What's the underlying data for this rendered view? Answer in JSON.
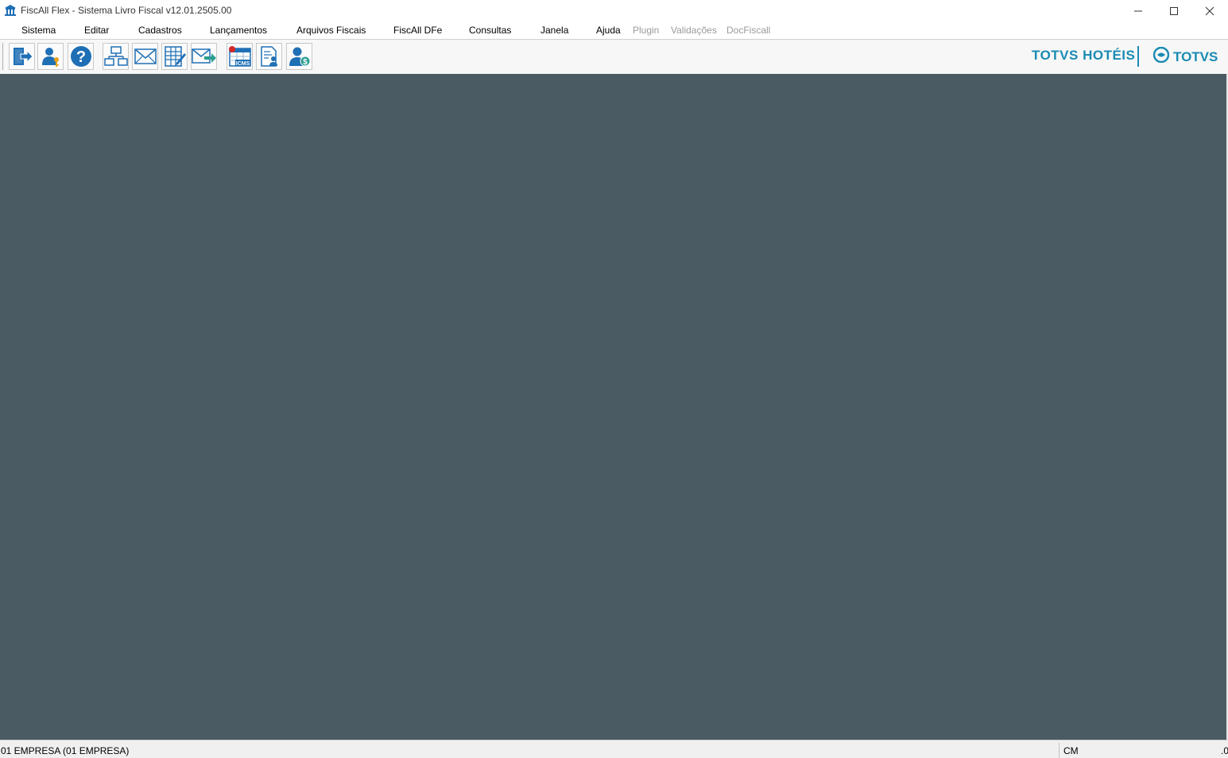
{
  "window": {
    "title": "FiscAll Flex - Sistema Livro Fiscal v12.01.2505.00",
    "icon": "app-building-icon",
    "controls": [
      "minimize-icon",
      "maximize-icon",
      "close-icon"
    ]
  },
  "menu": {
    "items": [
      {
        "label": "Sistema",
        "enabled": true
      },
      {
        "label": "Editar",
        "enabled": true
      },
      {
        "label": "Cadastros",
        "enabled": true
      },
      {
        "label": "Lançamentos",
        "enabled": true
      },
      {
        "label": "Arquivos Fiscais",
        "enabled": true
      },
      {
        "label": "FiscAll DFe",
        "enabled": true
      },
      {
        "label": "Consultas",
        "enabled": true
      },
      {
        "label": "Janela",
        "enabled": true
      },
      {
        "label": "Ajuda",
        "enabled": true
      },
      {
        "label": "Plugin",
        "enabled": false
      },
      {
        "label": "Validações",
        "enabled": false
      },
      {
        "label": "DocFiscall",
        "enabled": false
      }
    ]
  },
  "toolbar": {
    "buttons": [
      "exit-icon",
      "user-key-icon",
      "help-icon",
      "network-icon",
      "envelope-icon",
      "edit-spreadsheet-icon",
      "send-mail-icon",
      "icms-calendar-icon",
      "user-document-icon",
      "user-money-icon"
    ]
  },
  "brand": {
    "hoteis": "TOTVS HOTÉIS",
    "totvs": "TOTVS",
    "color": "#1a8bb3"
  },
  "workspace": {
    "background": "#4b5b63"
  },
  "status": {
    "company": "01 EMPRESA (01 EMPRESA)",
    "mode": "CM",
    "corner": ".0"
  }
}
